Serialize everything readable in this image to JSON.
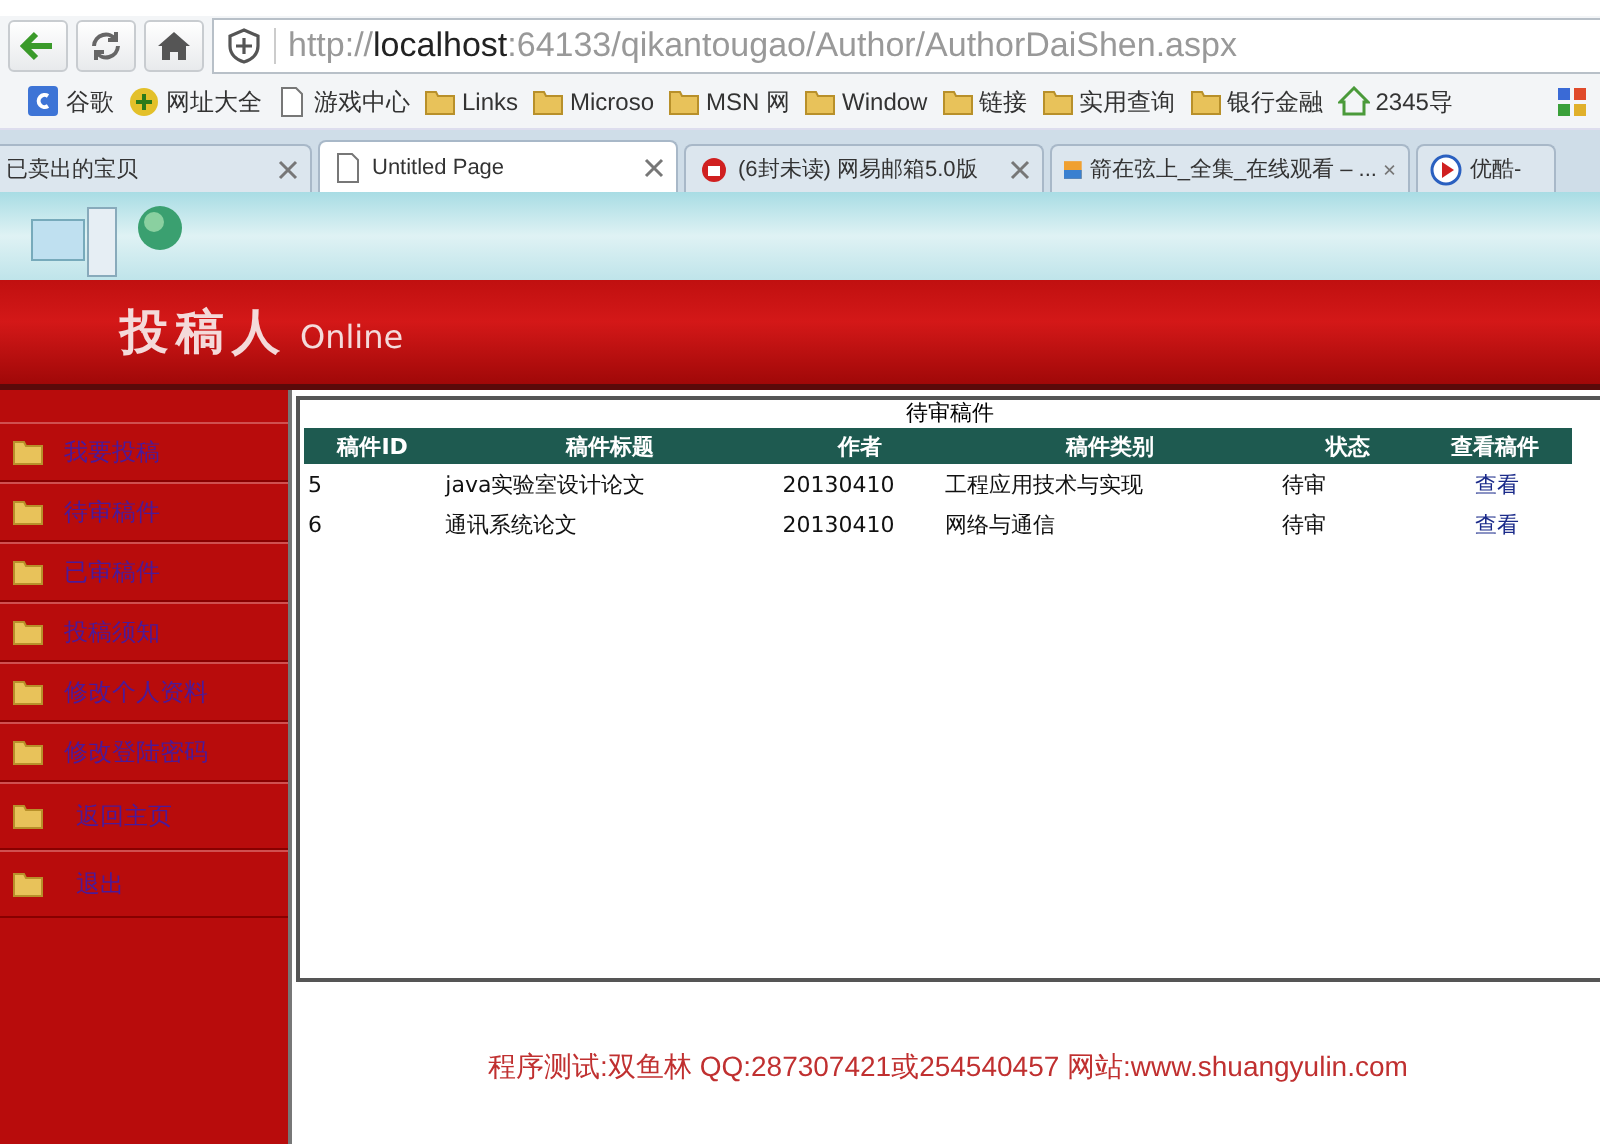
{
  "browser": {
    "address": {
      "scheme": "http://",
      "host": "localhost",
      "rest": ":64133/qikantougao/Author/AuthorDaiShen.aspx"
    },
    "bookmarks": [
      {
        "label": "谷歌",
        "kind": "google"
      },
      {
        "label": "网址大全",
        "kind": "plus"
      },
      {
        "label": "游戏中心",
        "kind": "page"
      },
      {
        "label": "Links",
        "kind": "folder"
      },
      {
        "label": "Microso",
        "kind": "folder"
      },
      {
        "label": "MSN 网",
        "kind": "folder"
      },
      {
        "label": "Window",
        "kind": "folder"
      },
      {
        "label": "链接",
        "kind": "folder"
      },
      {
        "label": "实用查询",
        "kind": "folder"
      },
      {
        "label": "银行金融",
        "kind": "folder"
      },
      {
        "label": "2345导",
        "kind": "house"
      }
    ],
    "tabs": [
      {
        "label": "已卖出的宝贝",
        "selected": false,
        "kind": "none"
      },
      {
        "label": "Untitled Page",
        "selected": true,
        "kind": "page"
      },
      {
        "label": "(6封未读) 网易邮箱5.0版",
        "selected": false,
        "kind": "mail"
      },
      {
        "label": "箭在弦上_全集_在线观看 – ...",
        "selected": false,
        "kind": "soku"
      },
      {
        "label": "优酷-",
        "selected": false,
        "kind": "play"
      }
    ]
  },
  "header": {
    "logo": "投稿人",
    "logo_suffix": "Online"
  },
  "sidebar": {
    "items": [
      {
        "label": "我要投稿"
      },
      {
        "label": "待审稿件"
      },
      {
        "label": "已审稿件"
      },
      {
        "label": "投稿须知"
      },
      {
        "label": "修改个人资料"
      },
      {
        "label": "修改登陆密码"
      },
      {
        "label": "返回主页"
      },
      {
        "label": "退出"
      }
    ]
  },
  "table": {
    "title": "待审稿件",
    "columns": [
      "稿件ID",
      "稿件标题",
      "作者",
      "稿件类别",
      "状态",
      "查看稿件"
    ],
    "rows": [
      [
        "5",
        "java实验室设计论文",
        "20130410",
        "工程应用技术与实现",
        "待审",
        "查看"
      ],
      [
        "6",
        "通讯系统论文",
        "20130410",
        "网络与通信",
        "待审",
        "查看"
      ]
    ]
  },
  "footer": "程序测试:双鱼林 QQ:287307421或254540457 网站:www.shuangyulin.com"
}
